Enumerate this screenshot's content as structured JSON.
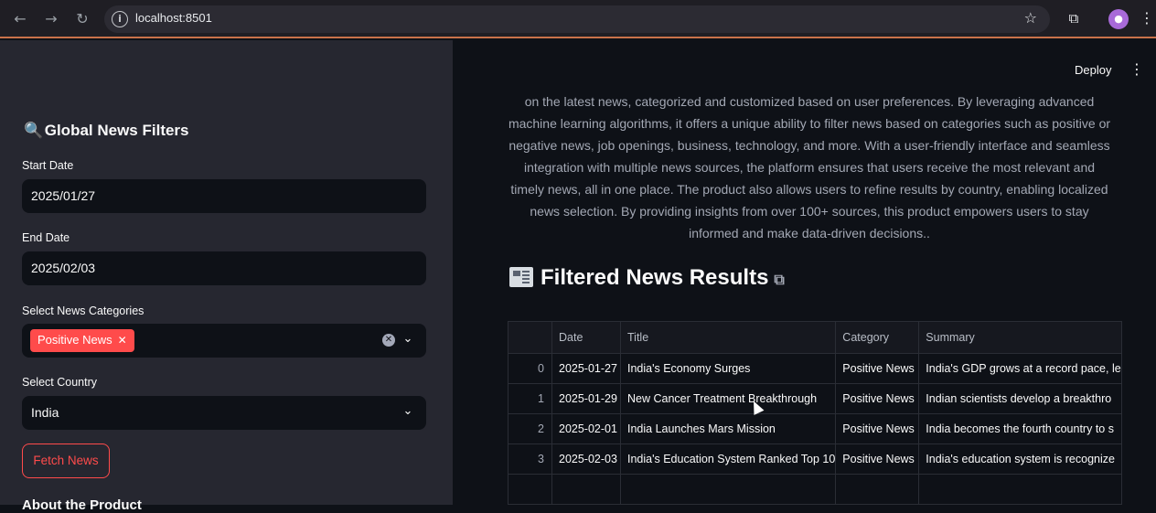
{
  "browser": {
    "url": "localhost:8501",
    "icons": [
      "back-icon",
      "forward-icon",
      "reload-icon",
      "info-icon",
      "star-icon",
      "extensions-icon",
      "avatar",
      "menu-icon"
    ]
  },
  "app": {
    "deploy_label": "Deploy",
    "menu_glyph": "⋮"
  },
  "sidebar": {
    "title": "Global News Filters",
    "title_icon": "magnifier-icon",
    "start_date_label": "Start Date",
    "start_date_value": "2025/01/27",
    "end_date_label": "End Date",
    "end_date_value": "2025/02/03",
    "categories_label": "Select News Categories",
    "selected_category": "Positive News",
    "country_label": "Select Country",
    "country_value": "India",
    "fetch_button": "Fetch News",
    "cut_heading": "About the Product"
  },
  "main": {
    "description": "on the latest news, categorized and customized based on user preferences. By leveraging advanced machine learning algorithms, it offers a unique ability to filter news based on categories such as positive or negative news, job openings, business, technology, and more. With a user-friendly interface and seamless integration with multiple news sources, the platform ensures that users receive the most relevant and timely news, all in one place. The product also allows users to refine results by country, enabling localized news selection. By providing insights from over 100+ sources, this product empowers users to stay informed and make data-driven decisions..",
    "results_heading": "Filtered News Results",
    "table": {
      "columns": [
        "",
        "Date",
        "Title",
        "Category",
        "Summary"
      ],
      "rows": [
        [
          "0",
          "2025-01-27",
          "India's Economy Surges",
          "Positive News",
          "India's GDP grows at a record pace, le"
        ],
        [
          "1",
          "2025-01-29",
          "New Cancer Treatment Breakthrough",
          "Positive News",
          "Indian scientists develop a breakthro"
        ],
        [
          "2",
          "2025-02-01",
          "India Launches Mars Mission",
          "Positive News",
          "India becomes the fourth country to s"
        ],
        [
          "3",
          "2025-02-03",
          "India's Education System Ranked Top 10",
          "Positive News",
          "India's education system is recognize"
        ]
      ]
    }
  },
  "colors": {
    "accent": "#ff4b4b",
    "sidebar_bg": "#262730",
    "main_bg": "#0e1117"
  }
}
